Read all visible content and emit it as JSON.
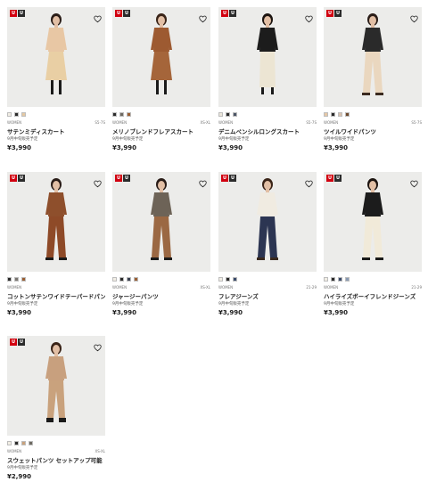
{
  "brand_letters": [
    "U",
    "U"
  ],
  "colors": {
    "brand_red": "#d10010",
    "thumb_bg": "#ececea"
  },
  "products": [
    {
      "name": "サテンミディスカート",
      "gender": "WOMEN",
      "size": "S5-7S",
      "note": "9月中旬販売予定",
      "price": "¥3,990",
      "swatches": [
        "#f1ede4",
        "#2b2b2b",
        "#e6c9a3"
      ],
      "icon": "heart-icon",
      "figure": {
        "top": "#e8c7a4",
        "bottom": "#e9cfa4",
        "shoes": "#1a1a1a",
        "hair": "#2a1d18",
        "style": "skirt"
      }
    },
    {
      "name": "メリノブレンドフレアスカート",
      "gender": "WOMEN",
      "size": "XS-XL",
      "note": "9月中旬販売予定",
      "price": "¥3,990",
      "swatches": [
        "#2b2b2b",
        "#6e6a62",
        "#9a5e33"
      ],
      "icon": "heart-icon",
      "figure": {
        "top": "#9d5a31",
        "bottom": "#a5653a",
        "shoes": "#1a1a1a",
        "hair": "#3a2418",
        "style": "skirt"
      }
    },
    {
      "name": "デニムペンシルロングスカート",
      "gender": "WOMEN",
      "size": "S5-7S",
      "note": "9月中旬販売予定",
      "price": "¥3,990",
      "swatches": [
        "#ebe6da",
        "#2b2b2b",
        "#4b5566"
      ],
      "icon": "heart-icon",
      "figure": {
        "top": "#1c1c1c",
        "bottom": "#ece5d3",
        "shoes": "#1a1a1a",
        "hair": "#1c1410",
        "style": "longskirt"
      }
    },
    {
      "name": "ツイルワイドパンツ",
      "gender": "WOMEN",
      "size": "S5-7S",
      "note": "9月中旬販売予定",
      "price": "¥3,990",
      "swatches": [
        "#e7c8a6",
        "#2b2b2b",
        "#d9c2ae",
        "#6f4a2e"
      ],
      "icon": "heart-icon",
      "figure": {
        "top": "#2a2a2a",
        "bottom": "#ead7bf",
        "shoes": "#3a2a1f",
        "hair": "#2a1d18",
        "style": "pants"
      }
    },
    {
      "name": "コットンサテンワイドテーパードパンツ",
      "gender": "WOMEN",
      "size": "",
      "note": "9月中旬販売予定",
      "price": "¥3,990",
      "swatches": [
        "#2b2b2b",
        "#7a7570",
        "#9a5e33"
      ],
      "icon": "heart-icon",
      "figure": {
        "top": "#8e4f2c",
        "bottom": "#8e4a28",
        "shoes": "#1a1a1a",
        "hair": "#2a1d18",
        "style": "pants"
      }
    },
    {
      "name": "ジャージーパンツ",
      "gender": "WOMEN",
      "size": "XS-XL",
      "note": "9月中旬販売予定",
      "price": "¥3,990",
      "swatches": [
        "#f1ede4",
        "#2b2b2b",
        "#3a4150",
        "#9a5e33"
      ],
      "icon": "heart-icon",
      "figure": {
        "top": "#6d6357",
        "bottom": "#9b6843",
        "shoes": "#1a1a1a",
        "hair": "#2a1d18",
        "style": "pants"
      }
    },
    {
      "name": "フレアジーンズ",
      "gender": "WOMEN",
      "size": "21-29",
      "note": "9月中旬販売予定",
      "price": "¥3,990",
      "swatches": [
        "#f1ede4",
        "#2b2b2b",
        "#3a4a6a"
      ],
      "icon": "heart-icon",
      "figure": {
        "top": "#f0ebe1",
        "bottom": "#2c3552",
        "shoes": "#3a2a1f",
        "hair": "#3a2418",
        "style": "pants"
      }
    },
    {
      "name": "ハイライズボーイフレンドジーンズ",
      "gender": "WOMEN",
      "size": "21-29",
      "note": "9月中旬販売予定",
      "price": "¥3,990",
      "swatches": [
        "#f1ede4",
        "#2b2b2b",
        "#3a4a6a",
        "#8a9bb3"
      ],
      "icon": "heart-icon",
      "figure": {
        "top": "#1c1c1c",
        "bottom": "#f1ead9",
        "shoes": "#1a1a1a",
        "hair": "#1c1410",
        "style": "pants"
      }
    },
    {
      "name": "スウェットパンツ セットアップ可能",
      "gender": "WOMEN",
      "size": "XS-XL",
      "note": "9月中旬販売予定",
      "price": "¥2,990",
      "swatches": [
        "#f1ede4",
        "#2b2b2b",
        "#c9a27c",
        "#6e6a62"
      ],
      "icon": "heart-icon",
      "figure": {
        "top": "#c8a07e",
        "bottom": "#c9a27d",
        "shoes": "#1a1a1a",
        "hair": "#3a2418",
        "style": "jogger"
      }
    }
  ]
}
